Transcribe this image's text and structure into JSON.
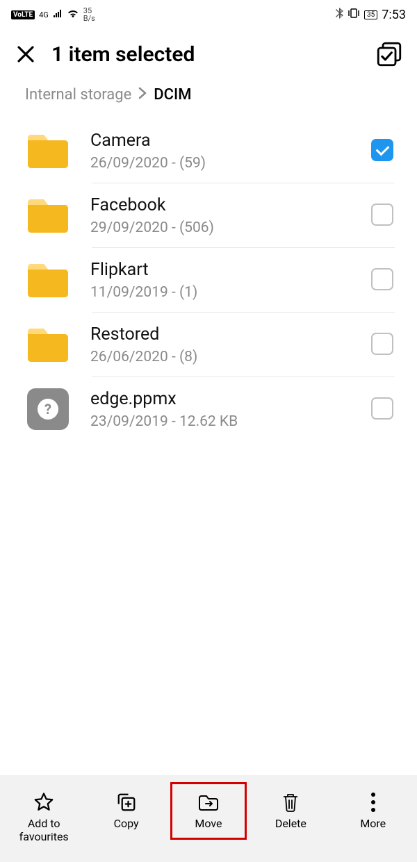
{
  "status": {
    "volte": "VoLTE",
    "network": "4G",
    "rate_top": "35",
    "rate_bottom": "B/s",
    "battery": "35",
    "time": "7:53"
  },
  "header": {
    "title": "1 item selected"
  },
  "breadcrumb": {
    "parent": "Internal storage",
    "current": "DCIM"
  },
  "items": [
    {
      "type": "folder",
      "name": "Camera",
      "meta": "26/09/2020 - (59)",
      "selected": true
    },
    {
      "type": "folder",
      "name": "Facebook",
      "meta": "29/09/2020 - (506)",
      "selected": false
    },
    {
      "type": "folder",
      "name": "Flipkart",
      "meta": "11/09/2019 - (1)",
      "selected": false
    },
    {
      "type": "folder",
      "name": "Restored",
      "meta": "26/06/2020 - (8)",
      "selected": false
    },
    {
      "type": "file",
      "name": "edge.ppmx",
      "meta": "23/09/2019 - 12.62 KB",
      "selected": false
    }
  ],
  "actions": {
    "favourites": "Add to favourites",
    "copy": "Copy",
    "move": "Move",
    "delete": "Delete",
    "more": "More"
  }
}
